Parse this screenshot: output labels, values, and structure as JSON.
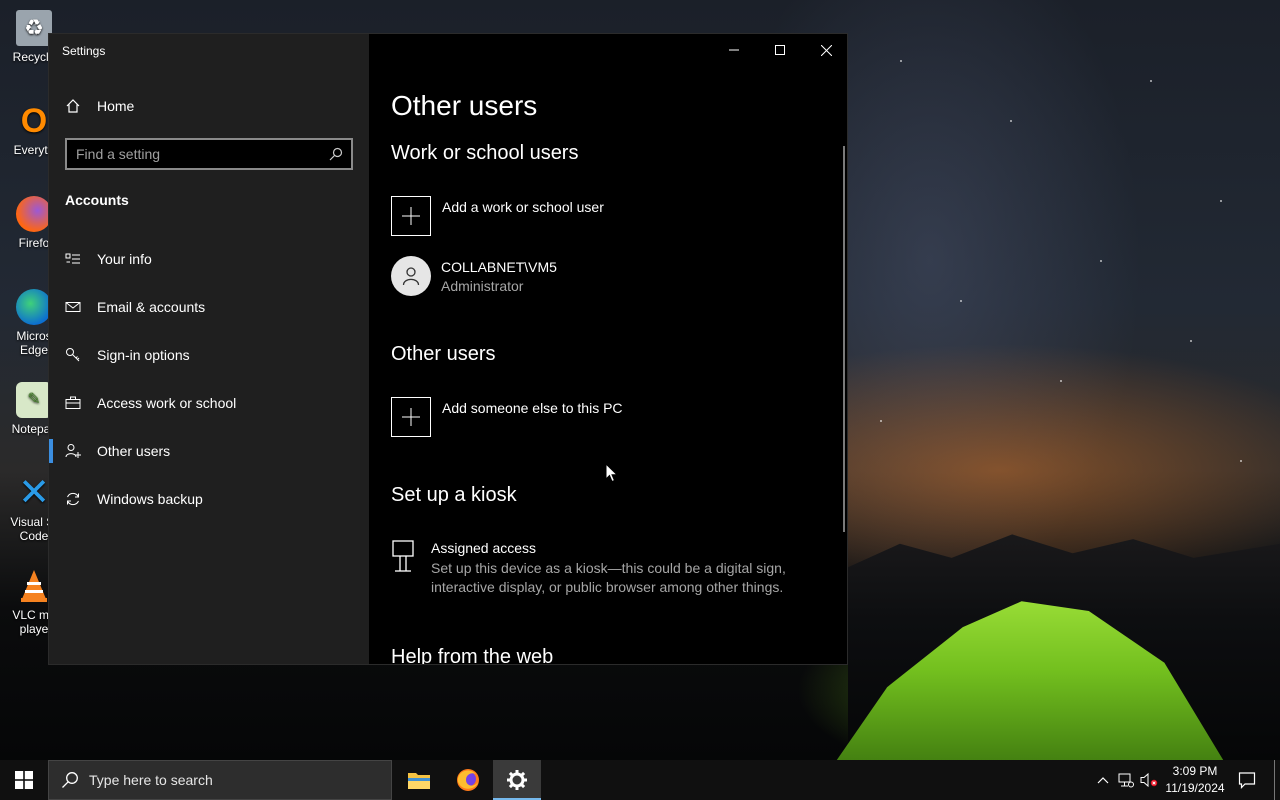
{
  "desktop": {
    "icons": [
      {
        "label": "Recycle",
        "icon": "recycle-bin-icon"
      },
      {
        "label": "Everyth",
        "icon": "everything-search-icon"
      },
      {
        "label": "Firefo",
        "icon": "firefox-icon"
      },
      {
        "label": "Micros Edge",
        "icon": "edge-icon"
      },
      {
        "label": "Notepac",
        "icon": "notepad-icon"
      },
      {
        "label": "Visual St Code",
        "icon": "vscode-icon"
      },
      {
        "label": "VLC me playe",
        "icon": "vlc-icon"
      }
    ]
  },
  "window": {
    "title": "Settings",
    "controls": {
      "minimize": "minimize-icon",
      "maximize": "maximize-icon",
      "close": "close-icon"
    }
  },
  "sidebar": {
    "home": "Home",
    "search_placeholder": "Find a setting",
    "section": "Accounts",
    "items": [
      {
        "label": "Your info",
        "icon": "contact-card-icon"
      },
      {
        "label": "Email & accounts",
        "icon": "mail-icon"
      },
      {
        "label": "Sign-in options",
        "icon": "key-icon"
      },
      {
        "label": "Access work or school",
        "icon": "briefcase-icon"
      },
      {
        "label": "Other users",
        "icon": "add-person-icon",
        "selected": true
      },
      {
        "label": "Windows backup",
        "icon": "sync-icon"
      }
    ]
  },
  "content": {
    "title": "Other users",
    "work": {
      "heading": "Work or school users",
      "add_label": "Add a work or school user",
      "user": {
        "name": "COLLABNET\\VM5",
        "role": "Administrator"
      }
    },
    "other": {
      "heading": "Other users",
      "add_label": "Add someone else to this PC"
    },
    "kiosk": {
      "heading": "Set up a kiosk",
      "title": "Assigned access",
      "description": "Set up this device as a kiosk—this could be a digital sign, interactive display, or public browser among other things."
    },
    "help": {
      "heading": "Help from the web"
    }
  },
  "taskbar": {
    "search_placeholder": "Type here to search",
    "time": "3:09 PM",
    "date": "11/19/2024"
  }
}
